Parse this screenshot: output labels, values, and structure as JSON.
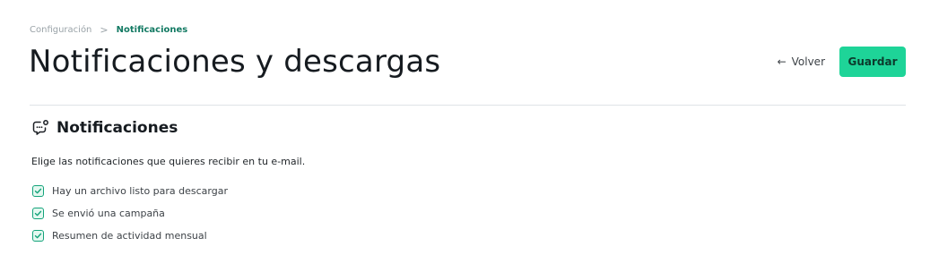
{
  "breadcrumb": {
    "items": [
      "Configuración",
      "Notificaciones"
    ],
    "separator": ">"
  },
  "page_title": "Notificaciones y descargas",
  "header": {
    "back_label": "Volver",
    "back_icon": "arrow-left-icon",
    "save_label": "Guardar"
  },
  "section": {
    "icon": "chat-bubble-icon",
    "title": "Notificaciones",
    "description": "Elige las notificaciones que quieres recibir en tu e-mail.",
    "options": [
      {
        "label": "Hay un archivo listo para descargar",
        "checked": true
      },
      {
        "label": "Se envió una campaña",
        "checked": true
      },
      {
        "label": "Resumen de actividad mensual",
        "checked": true
      }
    ]
  },
  "colors": {
    "accent": "#1ed498",
    "breadcrumb_active": "#137a63",
    "checkbox_border": "#13a37a"
  }
}
